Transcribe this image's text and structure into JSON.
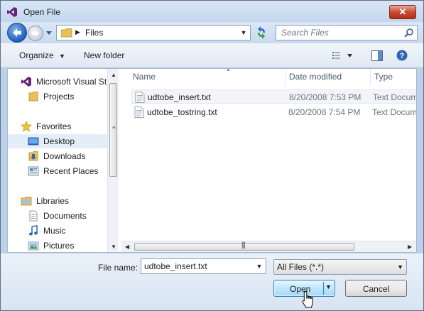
{
  "window": {
    "title": "Open File",
    "close_glyph": "✕"
  },
  "nav": {
    "address_path": "Files",
    "search_placeholder": "Search Files"
  },
  "toolbar": {
    "organize_label": "Organize",
    "new_folder_label": "New folder"
  },
  "sidebar": {
    "items": [
      {
        "label": "Microsoft Visual St",
        "icon": "visual-studio-icon"
      },
      {
        "label": "Projects",
        "icon": "folder-icon"
      },
      {
        "label": "Favorites",
        "icon": "star-icon"
      },
      {
        "label": "Desktop",
        "icon": "desktop-icon"
      },
      {
        "label": "Downloads",
        "icon": "downloads-folder-icon"
      },
      {
        "label": "Recent Places",
        "icon": "recent-places-icon"
      },
      {
        "label": "Libraries",
        "icon": "libraries-icon"
      },
      {
        "label": "Documents",
        "icon": "documents-icon"
      },
      {
        "label": "Music",
        "icon": "music-icon"
      },
      {
        "label": "Pictures",
        "icon": "pictures-icon"
      }
    ]
  },
  "files": {
    "columns": [
      "Name",
      "Date modified",
      "Type"
    ],
    "rows": [
      {
        "name": "udtobe_insert.txt",
        "date": "8/20/2008 7:53 PM",
        "type": "Text Docum"
      },
      {
        "name": "udtobe_tostring.txt",
        "date": "8/20/2008 7:54 PM",
        "type": "Text Docum"
      }
    ]
  },
  "footer": {
    "file_name_label": "File name:",
    "file_name_value": "udtobe_insert.txt",
    "file_type_value": "All Files (*.*)",
    "open_label": "Open",
    "cancel_label": "Cancel"
  },
  "colors": {
    "accent": "#1f5fb8",
    "selection": "#e4eef9",
    "close_button": "#c94a33"
  }
}
